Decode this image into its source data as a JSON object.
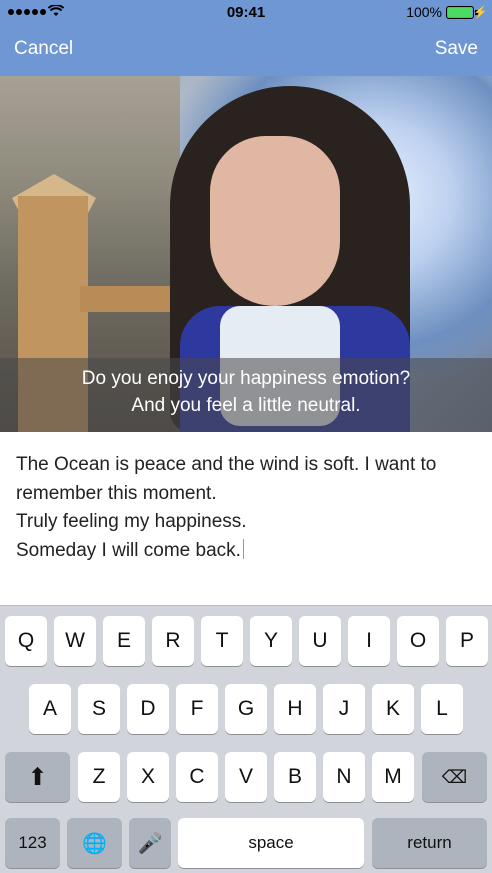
{
  "status_bar": {
    "time": "09:41",
    "battery_percent": "100%",
    "signal_bars": 5
  },
  "nav": {
    "left": "Cancel",
    "right": "Save",
    "bg_color": "#6f97d3"
  },
  "photo": {
    "caption_line1": "Do you enojy your happiness emotion?",
    "caption_line2": "And you feel a little neutral."
  },
  "editor": {
    "lines": [
      "The Ocean is peace and the wind is soft. I want to",
      "remember this moment.",
      "Truly feeling my happiness.",
      "Someday I will come back."
    ]
  },
  "keyboard": {
    "row1": [
      "Q",
      "W",
      "E",
      "R",
      "T",
      "Y",
      "U",
      "I",
      "O",
      "P"
    ],
    "row2": [
      "A",
      "S",
      "D",
      "F",
      "G",
      "H",
      "J",
      "K",
      "L"
    ],
    "row3": [
      "Z",
      "X",
      "C",
      "V",
      "B",
      "N",
      "M"
    ],
    "bottom": {
      "numbers": "123",
      "space": "space",
      "return": "return"
    },
    "icons": {
      "shift": "shift-arrow-icon",
      "delete": "backspace-icon",
      "globe": "globe-icon",
      "mic": "microphone-icon"
    }
  }
}
